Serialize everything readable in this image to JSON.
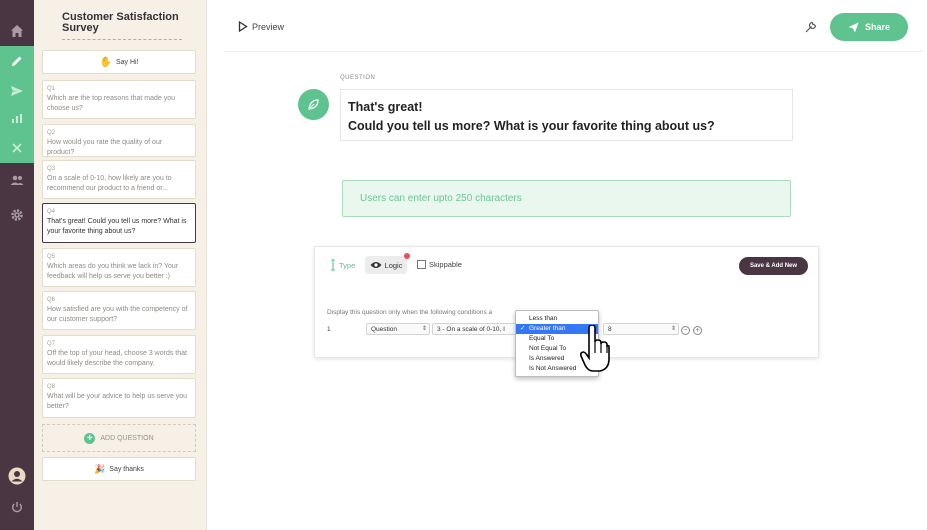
{
  "survey": {
    "title": "Customer Satisfaction Survey"
  },
  "sidebar": {
    "say_hi": "Say Hi!",
    "questions": [
      {
        "num": "Q1",
        "text": "Which are the top reasons that made you choose us?"
      },
      {
        "num": "Q2",
        "text": "How would you rate the quality of our product?"
      },
      {
        "num": "Q3",
        "text": "On a scale of 0-10, how likely are you to recommend our product to a friend or..."
      },
      {
        "num": "Q4",
        "text": "That's great! Could you tell us more? What is your favorite thing about us?"
      },
      {
        "num": "Q5",
        "text": "Which areas do you think we lack in? Your feedback will help us serve you better :)"
      },
      {
        "num": "Q6",
        "text": "How satisfied are you with the competency of our customer support?"
      },
      {
        "num": "Q7",
        "text": "Off the top of your head, choose 3 words that would likely describe the company."
      },
      {
        "num": "Q8",
        "text": "What will be your advice to help us serve you better?"
      }
    ],
    "add_question": "ADD QUESTION",
    "say_thanks": "Say thanks"
  },
  "topbar": {
    "preview": "Preview",
    "share": "Share"
  },
  "question": {
    "label": "QUESTION",
    "line1": "That's great!",
    "line2": "Could you tell us more? What is your favorite thing about us?"
  },
  "answer": {
    "placeholder": "Users can enter upto 250 characters"
  },
  "logic": {
    "tab_type": "Type",
    "tab_logic": "Logic",
    "skippable": "Skippable",
    "save_add": "Save & Add New",
    "condition_text": "Display this question only when the following conditions a",
    "row_number": "1",
    "field_select": "Question",
    "question_select": "3 - On a scale of 0-10, I",
    "value_select": "8",
    "operator_options": [
      "Less than",
      "Greater than",
      "Equal To",
      "Not Equal To",
      "Is Answered",
      "Is Not Answered"
    ],
    "operator_selected": "Greater than"
  },
  "colors": {
    "accent": "#5ec38e",
    "rail": "#4a3543",
    "panel": "#f6f0e7",
    "select_blue": "#3478f6"
  }
}
